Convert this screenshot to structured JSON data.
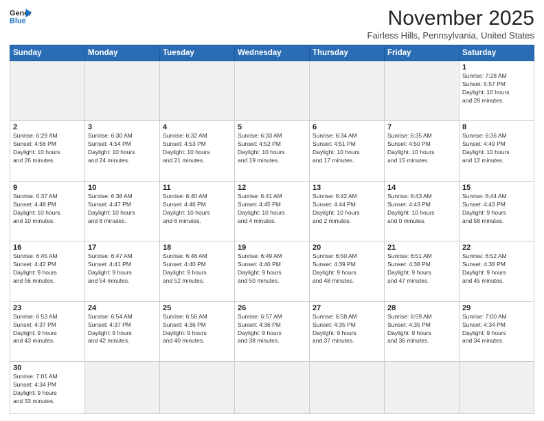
{
  "header": {
    "logo_line1": "General",
    "logo_line2": "Blue",
    "month": "November 2025",
    "location": "Fairless Hills, Pennsylvania, United States"
  },
  "days_of_week": [
    "Sunday",
    "Monday",
    "Tuesday",
    "Wednesday",
    "Thursday",
    "Friday",
    "Saturday"
  ],
  "weeks": [
    [
      {
        "day": "",
        "info": ""
      },
      {
        "day": "",
        "info": ""
      },
      {
        "day": "",
        "info": ""
      },
      {
        "day": "",
        "info": ""
      },
      {
        "day": "",
        "info": ""
      },
      {
        "day": "",
        "info": ""
      },
      {
        "day": "1",
        "info": "Sunrise: 7:28 AM\nSunset: 5:57 PM\nDaylight: 10 hours\nand 28 minutes."
      }
    ],
    [
      {
        "day": "2",
        "info": "Sunrise: 6:29 AM\nSunset: 4:56 PM\nDaylight: 10 hours\nand 26 minutes."
      },
      {
        "day": "3",
        "info": "Sunrise: 6:30 AM\nSunset: 4:54 PM\nDaylight: 10 hours\nand 24 minutes."
      },
      {
        "day": "4",
        "info": "Sunrise: 6:32 AM\nSunset: 4:53 PM\nDaylight: 10 hours\nand 21 minutes."
      },
      {
        "day": "5",
        "info": "Sunrise: 6:33 AM\nSunset: 4:52 PM\nDaylight: 10 hours\nand 19 minutes."
      },
      {
        "day": "6",
        "info": "Sunrise: 6:34 AM\nSunset: 4:51 PM\nDaylight: 10 hours\nand 17 minutes."
      },
      {
        "day": "7",
        "info": "Sunrise: 6:35 AM\nSunset: 4:50 PM\nDaylight: 10 hours\nand 15 minutes."
      },
      {
        "day": "8",
        "info": "Sunrise: 6:36 AM\nSunset: 4:49 PM\nDaylight: 10 hours\nand 12 minutes."
      }
    ],
    [
      {
        "day": "9",
        "info": "Sunrise: 6:37 AM\nSunset: 4:48 PM\nDaylight: 10 hours\nand 10 minutes."
      },
      {
        "day": "10",
        "info": "Sunrise: 6:38 AM\nSunset: 4:47 PM\nDaylight: 10 hours\nand 8 minutes."
      },
      {
        "day": "11",
        "info": "Sunrise: 6:40 AM\nSunset: 4:46 PM\nDaylight: 10 hours\nand 6 minutes."
      },
      {
        "day": "12",
        "info": "Sunrise: 6:41 AM\nSunset: 4:45 PM\nDaylight: 10 hours\nand 4 minutes."
      },
      {
        "day": "13",
        "info": "Sunrise: 6:42 AM\nSunset: 4:44 PM\nDaylight: 10 hours\nand 2 minutes."
      },
      {
        "day": "14",
        "info": "Sunrise: 6:43 AM\nSunset: 4:43 PM\nDaylight: 10 hours\nand 0 minutes."
      },
      {
        "day": "15",
        "info": "Sunrise: 6:44 AM\nSunset: 4:43 PM\nDaylight: 9 hours\nand 58 minutes."
      }
    ],
    [
      {
        "day": "16",
        "info": "Sunrise: 6:45 AM\nSunset: 4:42 PM\nDaylight: 9 hours\nand 56 minutes."
      },
      {
        "day": "17",
        "info": "Sunrise: 6:47 AM\nSunset: 4:41 PM\nDaylight: 9 hours\nand 54 minutes."
      },
      {
        "day": "18",
        "info": "Sunrise: 6:48 AM\nSunset: 4:40 PM\nDaylight: 9 hours\nand 52 minutes."
      },
      {
        "day": "19",
        "info": "Sunrise: 6:49 AM\nSunset: 4:40 PM\nDaylight: 9 hours\nand 50 minutes."
      },
      {
        "day": "20",
        "info": "Sunrise: 6:50 AM\nSunset: 4:39 PM\nDaylight: 9 hours\nand 48 minutes."
      },
      {
        "day": "21",
        "info": "Sunrise: 6:51 AM\nSunset: 4:38 PM\nDaylight: 9 hours\nand 47 minutes."
      },
      {
        "day": "22",
        "info": "Sunrise: 6:52 AM\nSunset: 4:38 PM\nDaylight: 9 hours\nand 45 minutes."
      }
    ],
    [
      {
        "day": "23",
        "info": "Sunrise: 6:53 AM\nSunset: 4:37 PM\nDaylight: 9 hours\nand 43 minutes."
      },
      {
        "day": "24",
        "info": "Sunrise: 6:54 AM\nSunset: 4:37 PM\nDaylight: 9 hours\nand 42 minutes."
      },
      {
        "day": "25",
        "info": "Sunrise: 6:56 AM\nSunset: 4:36 PM\nDaylight: 9 hours\nand 40 minutes."
      },
      {
        "day": "26",
        "info": "Sunrise: 6:57 AM\nSunset: 4:36 PM\nDaylight: 9 hours\nand 38 minutes."
      },
      {
        "day": "27",
        "info": "Sunrise: 6:58 AM\nSunset: 4:35 PM\nDaylight: 9 hours\nand 37 minutes."
      },
      {
        "day": "28",
        "info": "Sunrise: 6:59 AM\nSunset: 4:35 PM\nDaylight: 9 hours\nand 36 minutes."
      },
      {
        "day": "29",
        "info": "Sunrise: 7:00 AM\nSunset: 4:34 PM\nDaylight: 9 hours\nand 34 minutes."
      }
    ],
    [
      {
        "day": "30",
        "info": "Sunrise: 7:01 AM\nSunset: 4:34 PM\nDaylight: 9 hours\nand 33 minutes."
      },
      {
        "day": "",
        "info": ""
      },
      {
        "day": "",
        "info": ""
      },
      {
        "day": "",
        "info": ""
      },
      {
        "day": "",
        "info": ""
      },
      {
        "day": "",
        "info": ""
      },
      {
        "day": "",
        "info": ""
      }
    ]
  ]
}
